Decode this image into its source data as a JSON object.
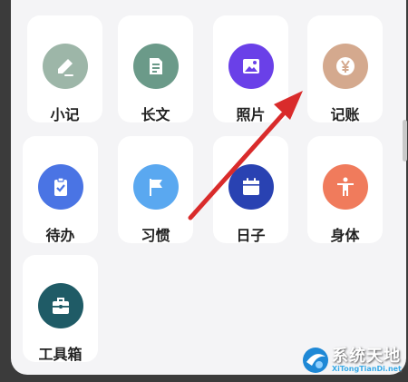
{
  "colors": {
    "panel_background": "#f4f4f6",
    "tile_background": "#ffffff",
    "label_text": "#222222",
    "arrow": "#d92b2b"
  },
  "grid": {
    "tiles": [
      {
        "id": "quick-note",
        "label": "小记",
        "icon": "pen-icon",
        "icon_bg": "#9db6a8"
      },
      {
        "id": "long-text",
        "label": "长文",
        "icon": "document-icon",
        "icon_bg": "#6b9a89"
      },
      {
        "id": "photo",
        "label": "照片",
        "icon": "image-icon",
        "icon_bg": "#6a40e8"
      },
      {
        "id": "bookkeeping",
        "label": "记账",
        "icon": "yen-coin-icon",
        "icon_bg": "#d4a98e"
      },
      {
        "id": "todo",
        "label": "待办",
        "icon": "clipboard-check-icon",
        "icon_bg": "#4a74e4"
      },
      {
        "id": "habit",
        "label": "习惯",
        "icon": "flag-icon",
        "icon_bg": "#5aa8f0"
      },
      {
        "id": "day",
        "label": "日子",
        "icon": "calendar-icon",
        "icon_bg": "#2942b2"
      },
      {
        "id": "body",
        "label": "身体",
        "icon": "person-icon",
        "icon_bg": "#f07b5c"
      },
      {
        "id": "toolbox",
        "label": "工具箱",
        "icon": "toolbox-icon",
        "icon_bg": "#1f5b66"
      }
    ]
  },
  "watermark": {
    "title": "系统天地",
    "url": "XiTongTianDi.net"
  }
}
